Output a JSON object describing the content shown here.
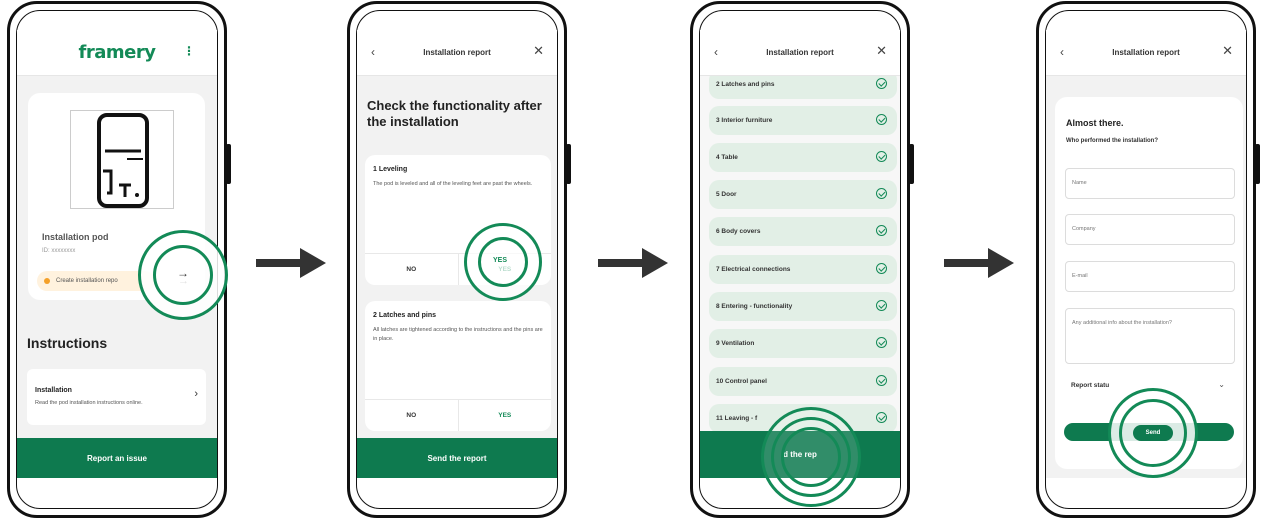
{
  "colors": {
    "brand": "#0e7a4f",
    "status_pending": "#f4a028",
    "check_bg": "#e2efe6"
  },
  "screen1": {
    "logo": "framery",
    "menu_icon": "kebab-menu-icon",
    "pod_name": "Installation pod",
    "pod_id": "ID: xxxxxxxx",
    "create_report": "Create installation repo",
    "instructions_heading": "Instructions",
    "instruction_card": {
      "title": "Installation",
      "description": "Read the pod installation instructions online."
    },
    "report_issue": "Report an issue"
  },
  "screen2": {
    "title": "Installation report",
    "heading": "Check the functionality after the installation",
    "questions": [
      {
        "title": "1 Leveling",
        "description": "The pod is leveled and all of the leveling feet are past the wheels.",
        "no": "NO",
        "yes": "YES"
      },
      {
        "title": "2 Latches and pins",
        "description": "All latches are tightened according to the instructions and the pins are in place.",
        "no": "NO",
        "yes": "YES"
      }
    ],
    "send": "Send the report"
  },
  "screen3": {
    "title": "Installation report",
    "items": [
      "2 Latches and pins",
      "3 Interior furniture",
      "4 Table",
      "5 Door",
      "6 Body covers",
      "7 Electrical connections",
      "8 Entering - functionality",
      "9 Ventilation",
      "10 Control panel",
      "11 Leaving - f"
    ],
    "send_partial": "d the rep"
  },
  "screen4": {
    "title": "Installation report",
    "heading": "Almost there.",
    "subheading": "Who performed the installation?",
    "fields": {
      "name": "Name",
      "company": "Company",
      "email": "E-mail",
      "additional": "Any additional info about the installation?"
    },
    "report_status": "Report statu",
    "send": "Send"
  }
}
